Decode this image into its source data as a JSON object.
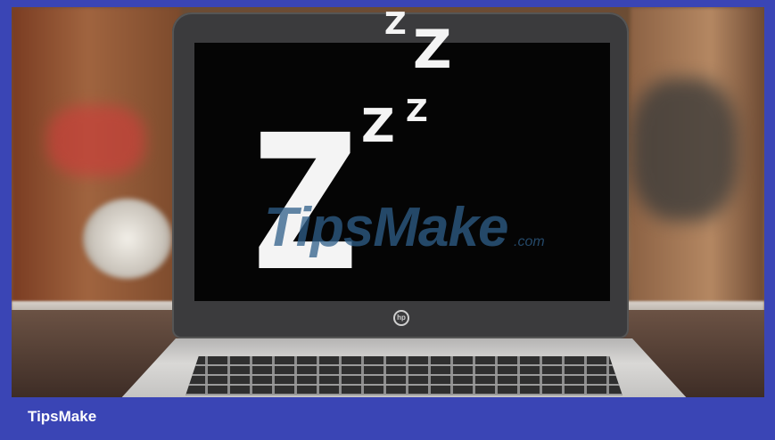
{
  "caption": {
    "text": "TipsMake"
  },
  "image": {
    "subject": "laptop-sleeping",
    "sleep_glyphs": [
      "Z",
      "Z",
      "Z",
      "Z",
      "Z"
    ],
    "watermark": "TipsMake",
    "watermark_suffix": ".com",
    "laptop_logo": "hp"
  },
  "colors": {
    "frame_border": "#3a45b5",
    "caption_bar": "#3a45b5",
    "screen": "#050505",
    "glyph": "#f4f4f4"
  }
}
